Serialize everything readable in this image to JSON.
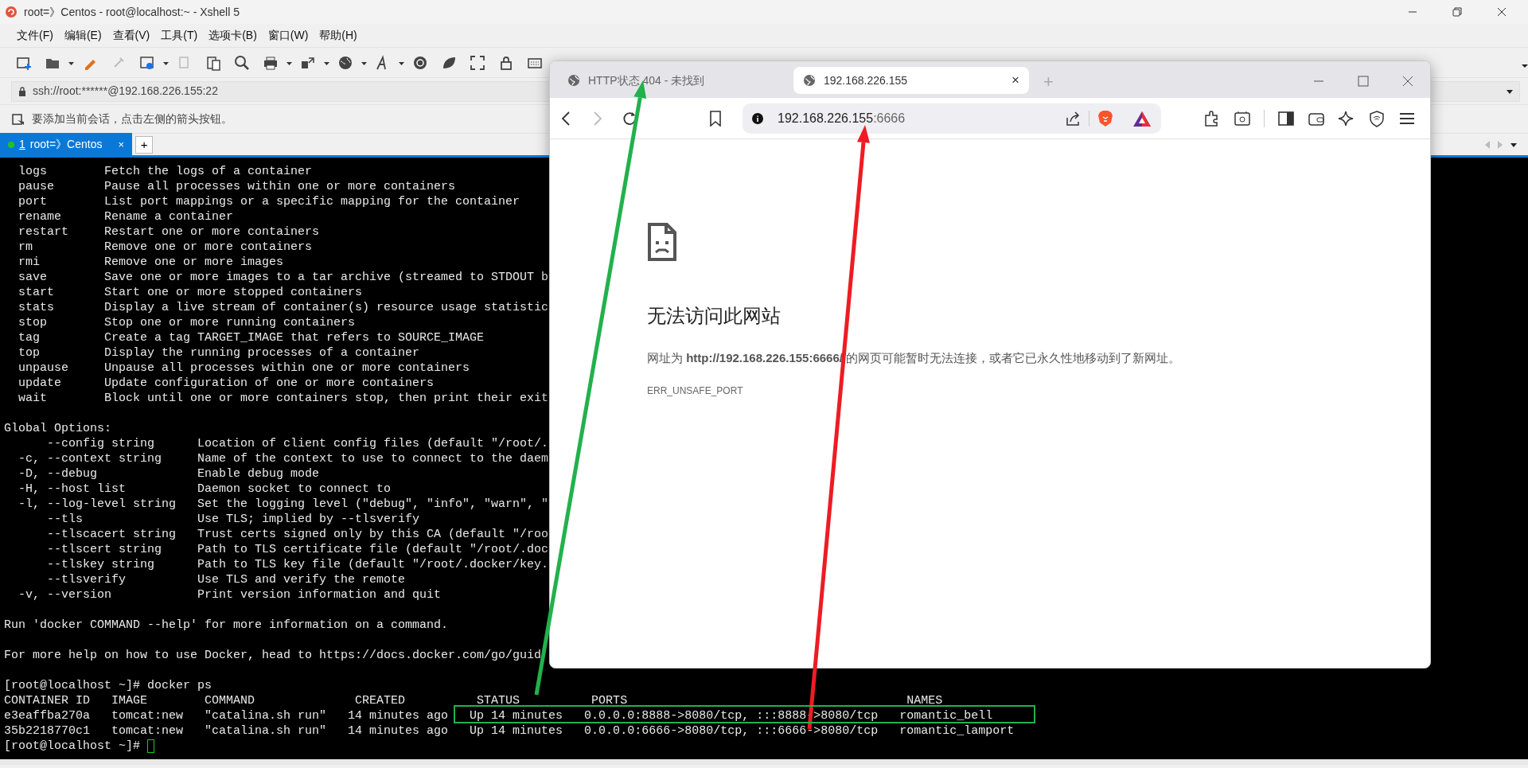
{
  "xshell": {
    "title": "root=》Centos - root@localhost:~ - Xshell 5",
    "menu": [
      "文件(F)",
      "编辑(E)",
      "查看(V)",
      "工具(T)",
      "选项卡(B)",
      "窗口(W)",
      "帮助(H)"
    ],
    "address": "ssh://root:******@192.168.226.155:22",
    "hint": "要添加当前会话，点击左侧的箭头按钮。",
    "tabs": [
      {
        "hotkey": "1",
        "label": "root=》Centos",
        "selected": true,
        "connected": true,
        "close": "×"
      }
    ],
    "new_tab": "+"
  },
  "terminal": {
    "blocks": [
      [
        "  logs        Fetch the logs of a container",
        "  pause       Pause all processes within one or more containers",
        "  port        List port mappings or a specific mapping for the container",
        "  rename      Rename a container",
        "  restart     Restart one or more containers",
        "  rm          Remove one or more containers",
        "  rmi         Remove one or more images",
        "  save        Save one or more images to a tar archive (streamed to STDOUT b",
        "  start       Start one or more stopped containers",
        "  stats       Display a live stream of container(s) resource usage statistic",
        "  stop        Stop one or more running containers",
        "  tag         Create a tag TARGET_IMAGE that refers to SOURCE_IMAGE",
        "  top         Display the running processes of a container",
        "  unpause     Unpause all processes within one or more containers",
        "  update      Update configuration of one or more containers",
        "  wait        Block until one or more containers stop, then print their exit"
      ],
      [
        "Global Options:",
        "      --config string      Location of client config files (default \"/root/.",
        "  -c, --context string     Name of the context to use to connect to the daem",
        "  -D, --debug              Enable debug mode",
        "  -H, --host list          Daemon socket to connect to",
        "  -l, --log-level string   Set the logging level (\"debug\", \"info\", \"warn\", \"",
        "      --tls                Use TLS; implied by --tlsverify",
        "      --tlscacert string   Trust certs signed only by this CA (default \"/roo",
        "      --tlscert string     Path to TLS certificate file (default \"/root/.doc",
        "      --tlskey string      Path to TLS key file (default \"/root/.docker/key.",
        "      --tlsverify          Use TLS and verify the remote",
        "  -v, --version            Print version information and quit"
      ],
      [
        "Run 'docker COMMAND --help' for more information on a command."
      ],
      [
        "For more help on how to use Docker, head to https://docs.docker.com/go/guid"
      ],
      [
        "[root@localhost ~]# docker ps",
        "CONTAINER ID   IMAGE        COMMAND              CREATED          STATUS          PORTS                                       NAMES",
        "e3eaffba270a   tomcat:new   \"catalina.sh run\"   14 minutes ago   Up 14 minutes   0.0.0.0:8888->8080/tcp, :::8888->8080/tcp   romantic_bell",
        "35b2218770c1   tomcat:new   \"catalina.sh run\"   14 minutes ago   Up 14 minutes   0.0.0.0:6666->8080/tcp, :::6666->8080/tcp   romantic_lamport"
      ]
    ],
    "prompt": "[root@localhost ~]#",
    "cursor": true
  },
  "browser": {
    "tabs": [
      {
        "title": "HTTP状态 404 - 未找到",
        "selected": false
      },
      {
        "title": "192.168.226.155",
        "selected": true,
        "close": "×"
      }
    ],
    "new_tab": "+",
    "back_disabled": false,
    "forward_disabled": true,
    "url": {
      "host": "192.168.226.155",
      "port": ":6666"
    },
    "error": {
      "title": "无法访问此网站",
      "message": "网址为 **http://192.168.226.155:6666/** 的网页可能暂时无法连接，或者它已永久性地移动到了新网址。",
      "code": "ERR_UNSAFE_PORT"
    }
  },
  "annotations": [
    {
      "kind": "arrow",
      "color": "#22b14c"
    },
    {
      "kind": "arrow",
      "color": "#ed1c24"
    },
    {
      "kind": "box",
      "color": "#22b14c"
    }
  ]
}
